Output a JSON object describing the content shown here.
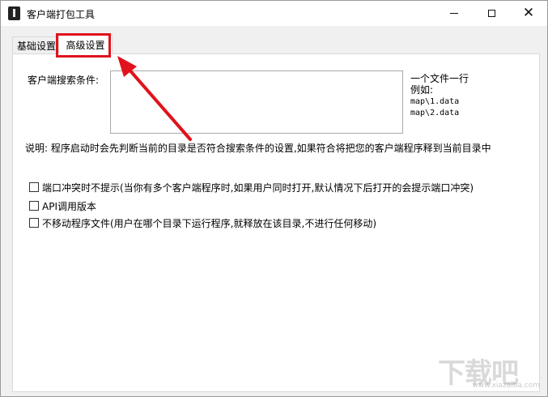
{
  "window": {
    "title": "客户端打包工具"
  },
  "tabs": [
    {
      "label": "基础设置"
    },
    {
      "label": "高级设置"
    }
  ],
  "advanced": {
    "search_label": "客户端搜索条件:",
    "search_value": "",
    "hint_line1": "一个文件一行",
    "hint_line2": "例如:",
    "example1": "map\\1.data",
    "example2": "map\\2.data",
    "description": "说明: 程序启动时会先判断当前的目录是否符合搜索条件的设置,如果符合将把您的客户端程序释到当前目录中",
    "options": [
      {
        "label": "端口冲突时不提示(当你有多个客户端程序时,如果用户同时打开,默认情况下后打开的会提示端口冲突)",
        "checked": false
      },
      {
        "label": "API调用版本",
        "checked": false
      },
      {
        "label": "不移动程序文件(用户在哪个目录下运行程序,就释放在该目录,不进行任何移动)",
        "checked": false
      }
    ]
  },
  "colors": {
    "annotation": "#e0121b"
  }
}
